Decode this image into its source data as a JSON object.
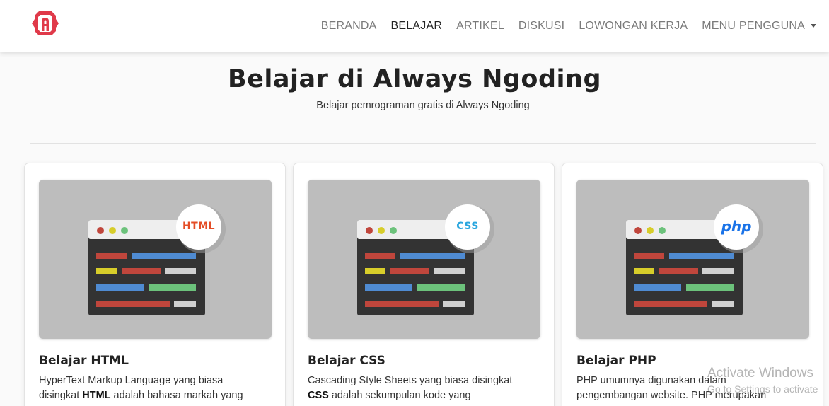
{
  "brand": {
    "logo_icon": "braces-a-logo-icon",
    "color": "#e03a4a"
  },
  "nav": {
    "items": [
      {
        "label": "BERANDA",
        "active": false
      },
      {
        "label": "BELAJAR",
        "active": true
      },
      {
        "label": "ARTIKEL",
        "active": false
      },
      {
        "label": "DISKUSI",
        "active": false
      },
      {
        "label": "LOWONGAN KERJA",
        "active": false
      },
      {
        "label": "MENU PENGGUNA",
        "active": false,
        "dropdown": true
      }
    ]
  },
  "header": {
    "title": "Belajar di Always Ngoding",
    "subtitle": "Belajar pemrograman gratis di Always Ngoding"
  },
  "cards": [
    {
      "badge": "HTML",
      "badge_color": "#e44d26",
      "title": "Belajar HTML",
      "text_line1": "HyperText Markup Language yang biasa",
      "text_pre": "disingkat ",
      "text_bold": "HTML",
      "text_post": " adalah bahasa markah yang"
    },
    {
      "badge": "CSS",
      "badge_color": "#2aa6de",
      "title": "Belajar CSS",
      "text_line1": "Cascading Style Sheets yang biasa disingkat",
      "text_pre": "",
      "text_bold": "CSS",
      "text_post": " adalah sekumpulan kode yang"
    },
    {
      "badge": "php",
      "badge_color": "#1a73e8",
      "title": "Belajar PHP",
      "text_line1": "PHP umumnya digunakan dalam",
      "text_pre": "pengembangan website. PHP merupakan",
      "text_bold": "",
      "text_post": ""
    }
  ],
  "watermark": {
    "line1": "Activate Windows",
    "line2": "Go to Settings to activate"
  },
  "colors": {
    "page_bg": "#fafafa",
    "card_image_bg": "#bdbdbd",
    "code_red": "#c0463c",
    "code_blue": "#4f8bd2",
    "code_yellow": "#d7cd2a",
    "code_green": "#6cc27b",
    "code_gray": "#d0d0d0"
  }
}
